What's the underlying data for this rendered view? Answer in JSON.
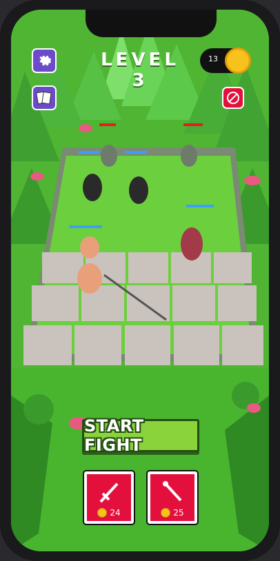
{
  "hud": {
    "level_label": "LEVEL 3",
    "coins": "13",
    "icons": {
      "settings": "gear-icon",
      "cards": "cards-icon",
      "no_ads": "no-ads-icon",
      "coin": "coin-icon"
    }
  },
  "actions": {
    "start_fight": "START FIGHT"
  },
  "shop": [
    {
      "icon": "sword-icon",
      "price": "24"
    },
    {
      "icon": "magic-wand-icon",
      "price": "25"
    }
  ],
  "colors": {
    "grass": "#5cc23a",
    "card_red": "#e3103e",
    "coin_gold": "#f7c21b",
    "start_button": "#8ad33a",
    "enemy_health": "#e02020",
    "ally_health": "#3aa0ff"
  }
}
